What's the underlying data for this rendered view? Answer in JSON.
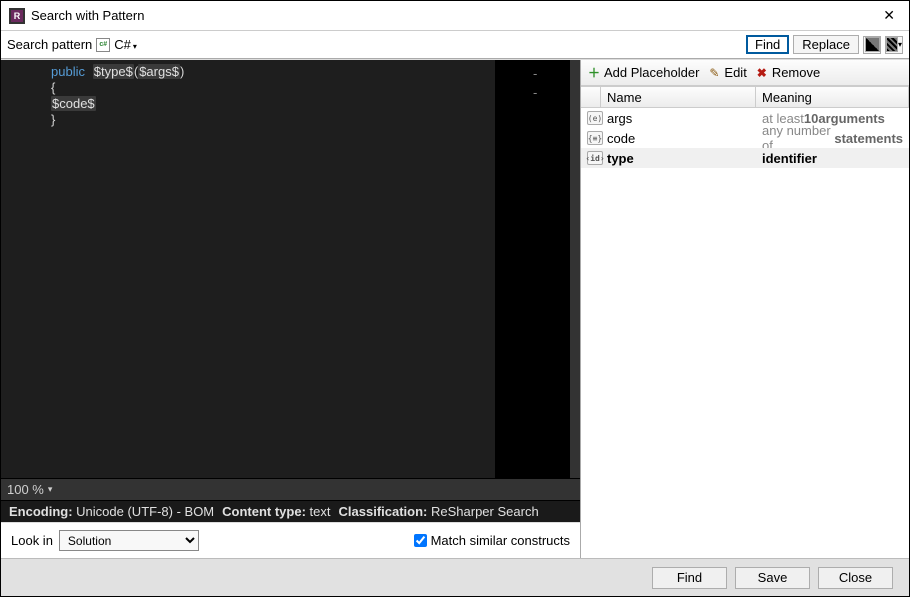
{
  "window": {
    "title": "Search with Pattern"
  },
  "toolbar": {
    "search_pattern_label": "Search pattern",
    "language": "C#",
    "find_label": "Find",
    "replace_label": "Replace"
  },
  "editor": {
    "code_line1_kw": "public",
    "code_line1_ph1": "$type$",
    "code_line1_paren_open": "(",
    "code_line1_ph2": "$args$",
    "code_line1_paren_close": ")",
    "code_line2": "{",
    "code_line3_ph": "$code$",
    "code_line4": "}",
    "zoom": "100 %",
    "info_encoding_label": "Encoding:",
    "info_encoding_value": "Unicode (UTF-8) - BOM",
    "info_ctype_label": "Content type:",
    "info_ctype_value": "text",
    "info_class_label": "Classification:",
    "info_class_value": "ReSharper Search"
  },
  "lookin": {
    "label": "Look in",
    "selected": "Solution",
    "options": [
      "Solution"
    ],
    "match_label": "Match similar constructs",
    "match_checked": true
  },
  "right": {
    "add_label": "Add Placeholder",
    "edit_label": "Edit",
    "remove_label": "Remove",
    "col_name": "Name",
    "col_meaning": "Meaning",
    "rows": [
      {
        "icon": "(e)",
        "name": "args",
        "meaning_prefix": "at least ",
        "meaning_bold1": "10",
        "meaning_mid": " ",
        "meaning_bold2": "arguments",
        "selected": false
      },
      {
        "icon": "{≡}",
        "name": "code",
        "meaning_prefix": "any number of ",
        "meaning_bold1": "",
        "meaning_mid": "",
        "meaning_bold2": "statements",
        "selected": false
      },
      {
        "icon": "‹id›",
        "name": "type",
        "meaning_plain": "identifier",
        "selected": true
      }
    ]
  },
  "footer": {
    "find": "Find",
    "save": "Save",
    "close": "Close"
  }
}
